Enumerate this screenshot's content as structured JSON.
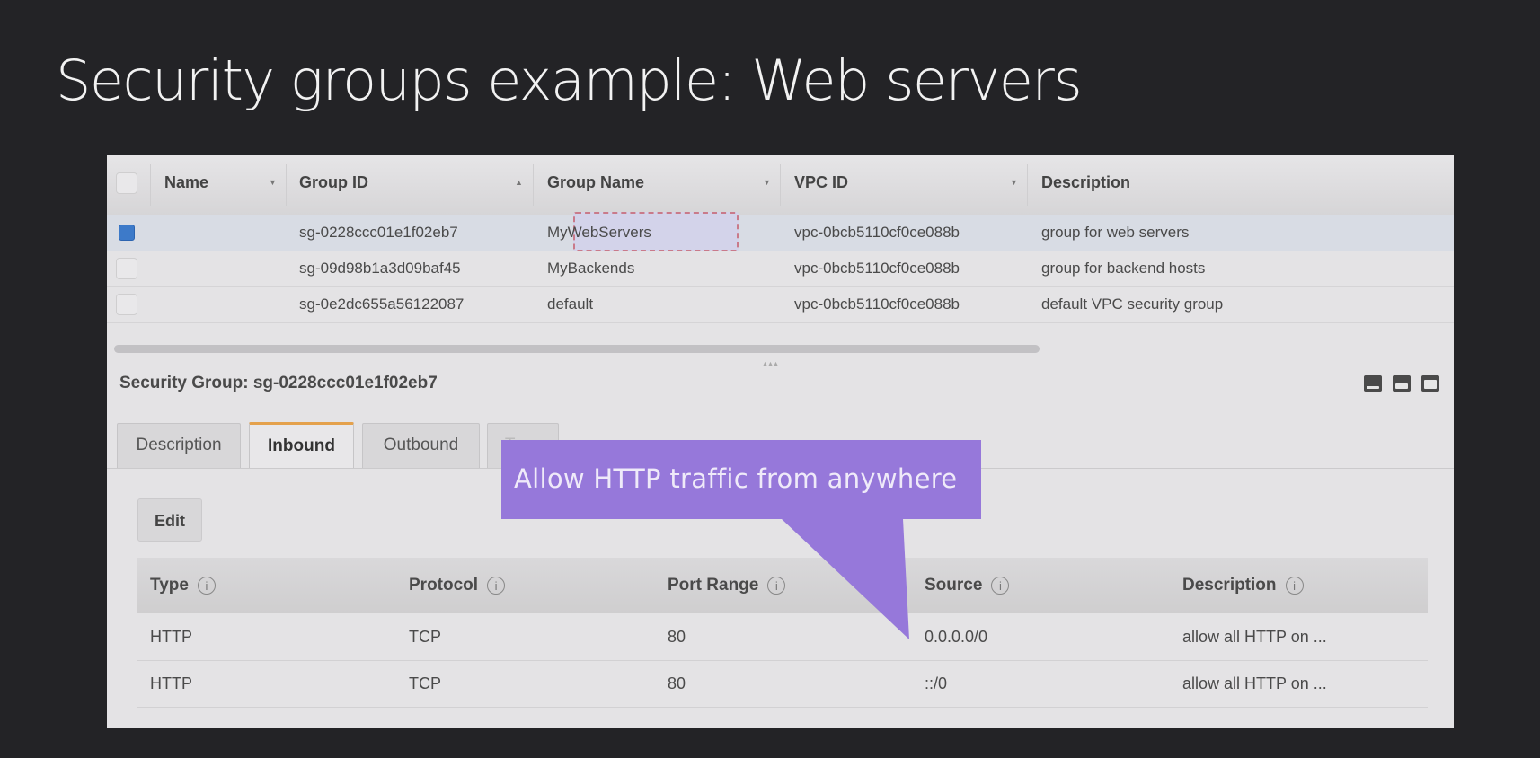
{
  "slide": {
    "title": "Security groups example: Web servers"
  },
  "grid": {
    "columns": [
      {
        "label": "Name",
        "sort": "filter"
      },
      {
        "label": "Group ID",
        "sort": "ascending"
      },
      {
        "label": "Group Name",
        "sort": "filter"
      },
      {
        "label": "VPC ID",
        "sort": "filter"
      },
      {
        "label": "Description"
      }
    ],
    "rows": [
      {
        "selected": true,
        "name": "",
        "group_id": "sg-0228ccc01e1f02eb7",
        "group_name": "MyWebServers",
        "vpc_id": "vpc-0bcb5110cf0ce088b",
        "description": "group for web servers"
      },
      {
        "selected": false,
        "name": "",
        "group_id": "sg-09d98b1a3d09baf45",
        "group_name": "MyBackends",
        "vpc_id": "vpc-0bcb5110cf0ce088b",
        "description": "group for backend hosts"
      },
      {
        "selected": false,
        "name": "",
        "group_id": "sg-0e2dc655a56122087",
        "group_name": "default",
        "vpc_id": "vpc-0bcb5110cf0ce088b",
        "description": "default VPC security group"
      }
    ]
  },
  "detail": {
    "title": "Security Group: sg-0228ccc01e1f02eb7",
    "pane_icons": [
      "pane-bottom-small-icon",
      "pane-bottom-medium-icon",
      "pane-bottom-large-icon"
    ],
    "tabs": [
      {
        "label": "Description",
        "active": false
      },
      {
        "label": "Inbound",
        "active": true
      },
      {
        "label": "Outbound",
        "active": false
      },
      {
        "label": "Tags",
        "active": false
      }
    ],
    "edit_label": "Edit",
    "info_glyph": "i",
    "rules": {
      "columns": [
        "Type",
        "Protocol",
        "Port Range",
        "Source",
        "Description"
      ],
      "rows": [
        {
          "type": "HTTP",
          "protocol": "TCP",
          "port_range": "80",
          "source": "0.0.0.0/0",
          "description": "allow all HTTP on ..."
        },
        {
          "type": "HTTP",
          "protocol": "TCP",
          "port_range": "80",
          "source": "::/0",
          "description": "allow all HTTP on ..."
        }
      ]
    }
  },
  "callout": {
    "text": "Allow HTTP traffic from anywhere",
    "color": "#9678da"
  },
  "colors": {
    "selected_checkbox": "#3d7ac9",
    "active_tab_accent": "#e4a14c",
    "highlight_border": "#c97a8a"
  }
}
